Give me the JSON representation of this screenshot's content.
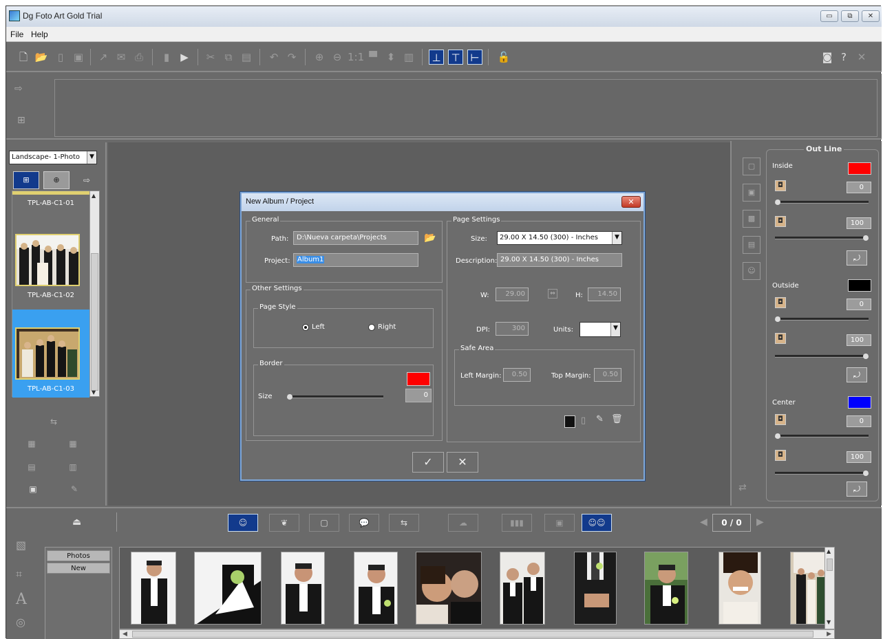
{
  "window": {
    "title": "Dg Foto Art Gold Trial"
  },
  "menu": {
    "file": "File",
    "help": "Help"
  },
  "left": {
    "layout_select": "Landscape- 1-Photo",
    "templates": [
      {
        "label": "TPL-AB-C1-01"
      },
      {
        "label": "TPL-AB-C1-02"
      },
      {
        "label": "TPL-AB-C1-03"
      }
    ]
  },
  "outline": {
    "title": "Out Line",
    "inside": {
      "label": "Inside",
      "color": "#ff0000",
      "v1": "0",
      "v2": "100"
    },
    "outside": {
      "label": "Outside",
      "color": "#000000",
      "v1": "0",
      "v2": "100"
    },
    "center": {
      "label": "Center",
      "color": "#0000ff",
      "v1": "0",
      "v2": "100"
    }
  },
  "dialog": {
    "title": "New Album / Project",
    "general": {
      "label": "General",
      "path_label": "Path:",
      "path_value": "D:\\Nueva carpeta\\Projects",
      "project_label": "Project:",
      "project_value": "Album1"
    },
    "other": {
      "label": "Other Settings",
      "page_style_label": "Page Style",
      "left": "Left",
      "right": "Right",
      "border_label": "Border",
      "size_label": "Size",
      "size_value": "0",
      "border_color": "#ff0000"
    },
    "page": {
      "label": "Page Settings",
      "size_label": "Size:",
      "size_value": "29.00 X 14.50 (300) - Inches",
      "desc_label": "Description:",
      "desc_value": "29.00 X 14.50 (300) - Inches",
      "w_label": "W:",
      "w_value": "29.00",
      "h_label": "H:",
      "h_value": "14.50",
      "dpi_label": "DPI:",
      "dpi_value": "300",
      "units_label": "Units:",
      "safe_label": "Safe Area",
      "left_margin_label": "Left Margin:",
      "left_margin_value": "0.50",
      "top_margin_label": "Top Margin:",
      "top_margin_value": "0.50"
    }
  },
  "bottom": {
    "page_count": "0 / 0",
    "tabs": [
      "Photos",
      "New"
    ]
  }
}
